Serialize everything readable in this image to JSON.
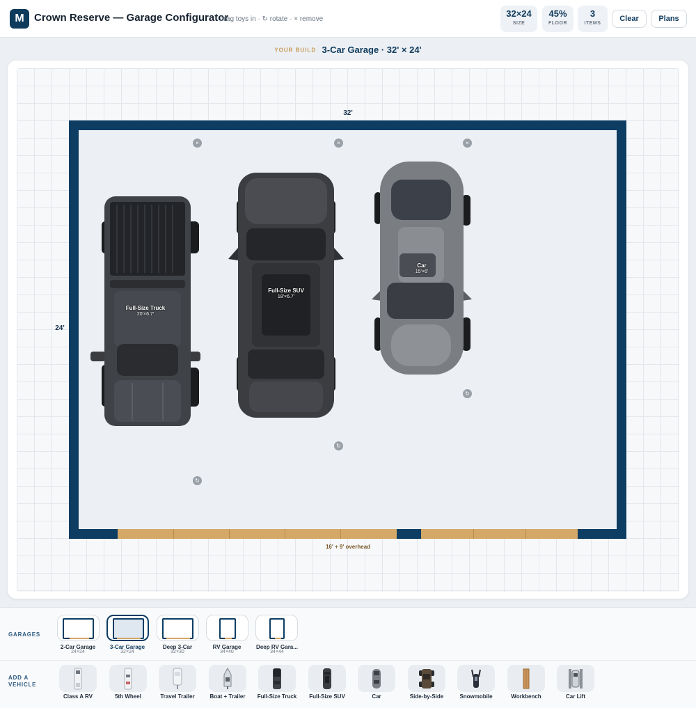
{
  "header": {
    "logo": "M",
    "title": "Crown Reserve — Garage Configurator",
    "hint": "drag toys in · ↻ rotate · × remove",
    "stats": [
      {
        "value": "32×24",
        "label": "SIZE"
      },
      {
        "value": "45%",
        "label": "FLOOR"
      },
      {
        "value": "3",
        "label": "ITEMS"
      }
    ],
    "clear_label": "Clear",
    "plans_label": "Plans"
  },
  "build": {
    "kicker": "YOUR BUILD",
    "name": "3-Car Garage · 32' × 24'"
  },
  "canvas": {
    "width_label": "32'",
    "depth_label": "24'",
    "door_label": "16' + 9' overhead",
    "colors": {
      "wall": "#0d3d63",
      "door": "#d4a867",
      "floor": "#ecf0f4"
    },
    "vehicles": [
      {
        "name": "Full-Size Truck",
        "size": "20'×6.7'",
        "color": "#3f4247"
      },
      {
        "name": "Full-Size SUV",
        "size": "18'×6.7'",
        "color": "#3b3d41"
      },
      {
        "name": "Car",
        "size": "15'×6'",
        "color": "#7a7d82"
      }
    ],
    "remove_icon": "×",
    "rotate_icon": "↻"
  },
  "tray": {
    "garages_label": "GARAGES",
    "add_vehicle_label": "ADD A VEHICLE",
    "garages": [
      {
        "name": "2-Car Garage",
        "size": "24×24",
        "selected": false
      },
      {
        "name": "3-Car Garage",
        "size": "32×24",
        "selected": true
      },
      {
        "name": "Deep 3-Car",
        "size": "32×30",
        "selected": false
      },
      {
        "name": "RV Garage",
        "size": "34×40",
        "selected": false
      },
      {
        "name": "Deep RV Gara...",
        "size": "34×44",
        "selected": false
      }
    ],
    "vehicles": [
      {
        "name": "Class A RV",
        "icon": "class-a-rv-icon"
      },
      {
        "name": "5th Wheel",
        "icon": "fifth-wheel-icon"
      },
      {
        "name": "Travel Trailer",
        "icon": "travel-trailer-icon"
      },
      {
        "name": "Boat + Trailer",
        "icon": "boat-trailer-icon"
      },
      {
        "name": "Full-Size Truck",
        "icon": "truck-icon"
      },
      {
        "name": "Full-Size SUV",
        "icon": "suv-icon"
      },
      {
        "name": "Car",
        "icon": "car-icon"
      },
      {
        "name": "Side-by-Side",
        "icon": "side-by-side-icon"
      },
      {
        "name": "Snowmobile",
        "icon": "snowmobile-icon"
      },
      {
        "name": "Workbench",
        "icon": "workbench-icon"
      },
      {
        "name": "Car Lift",
        "icon": "car-lift-icon"
      }
    ]
  }
}
